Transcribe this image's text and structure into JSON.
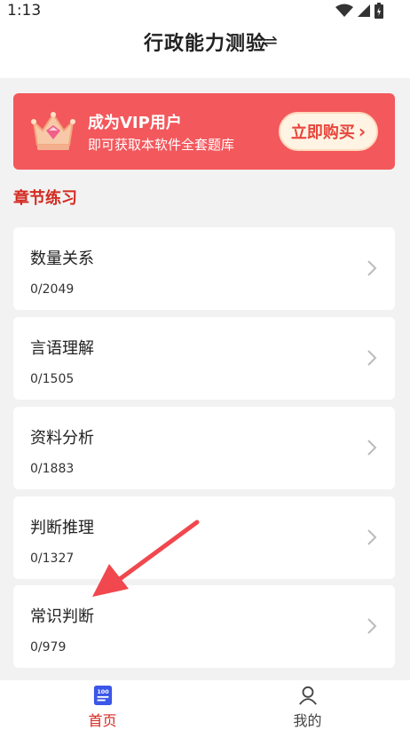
{
  "status_bar": {
    "time": "1:13",
    "icons": [
      "wifi-icon",
      "signal-icon",
      "battery-icon"
    ]
  },
  "header": {
    "title": "行政能力测验",
    "switch_icon": "⇌"
  },
  "vip_banner": {
    "title": "成为VIP用户",
    "subtitle": "即可获取本软件全套题库",
    "buy_label": "立即购买",
    "buy_chevron": "›",
    "colors": {
      "background": "#f3585c",
      "button": "#fff3e4",
      "button_text": "#e8463c"
    }
  },
  "section": {
    "title": "章节练习",
    "color": "#d42a20"
  },
  "chapters": [
    {
      "name": "数量关系",
      "progress": "0/2049"
    },
    {
      "name": "言语理解",
      "progress": "0/1505"
    },
    {
      "name": "资料分析",
      "progress": "0/1883"
    },
    {
      "name": "判断推理",
      "progress": "0/1327"
    },
    {
      "name": "常识判断",
      "progress": "0/979"
    }
  ],
  "tabbar": {
    "home_label": "首页",
    "mine_label": "我的",
    "active": "home",
    "active_color": "#d42a20"
  },
  "annotation": {
    "arrow_color": "#f0484e"
  }
}
